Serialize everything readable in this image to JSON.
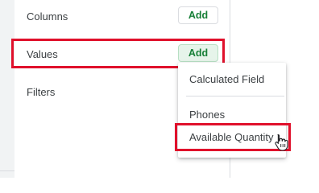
{
  "panel": {
    "sections": {
      "columns": {
        "label": "Columns",
        "add_label": "Add"
      },
      "values": {
        "label": "Values",
        "add_label": "Add"
      },
      "filters": {
        "label": "Filters"
      }
    }
  },
  "dropdown": {
    "items": [
      "Calculated Field",
      "Phones",
      "Available Quantity"
    ]
  },
  "colors": {
    "add_text": "#188038",
    "highlight": "#e0102b"
  },
  "icons": {
    "cursor": "hand-pointer-icon"
  }
}
